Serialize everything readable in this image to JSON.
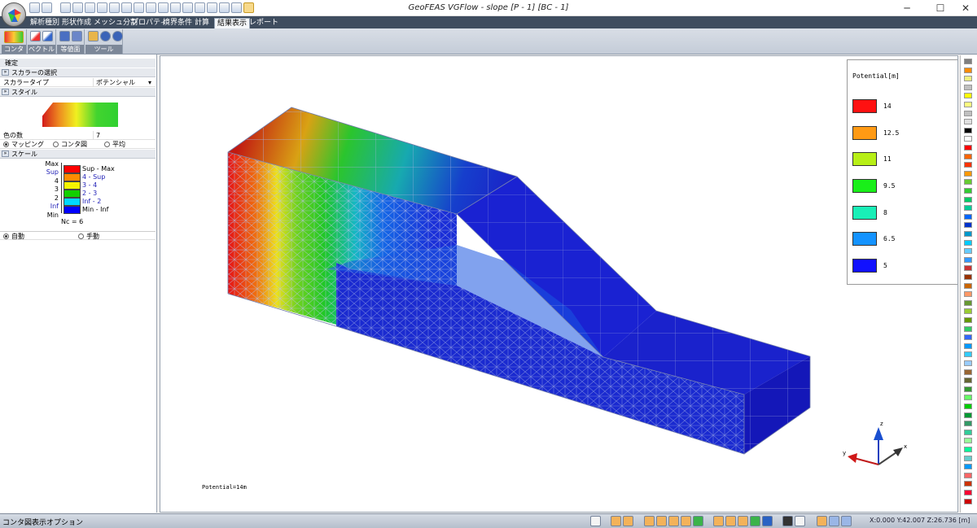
{
  "window": {
    "title": "GeoFEAS VGFlow - slope [P - 1] [BC - 1]",
    "minimize": "─",
    "maximize": "☐",
    "close": "✕"
  },
  "menu": {
    "tabs": [
      {
        "label": "解析種別"
      },
      {
        "label": "形状作成"
      },
      {
        "label": "メッシュ分割"
      },
      {
        "label": "プロパティ"
      },
      {
        "label": "境界条件"
      },
      {
        "label": "計算"
      },
      {
        "label": "結果表示"
      },
      {
        "label": "レポート"
      }
    ],
    "active_tab": "結果表示"
  },
  "ribbon": {
    "groups": [
      {
        "label": "コンタ図"
      },
      {
        "label": "ベクトル"
      },
      {
        "label": "等値面"
      },
      {
        "label": "ツール"
      }
    ]
  },
  "panel": {
    "confirm_label": "確定",
    "scalar_section": "スカラーの選択",
    "scalar_type_label": "スカラータイプ",
    "scalar_type_value": "ポテンシャル",
    "style_section": "スタイル",
    "num_colors_label": "色の数",
    "num_colors_value": "7",
    "mode_options": [
      "マッピング",
      "コンタ図",
      "平均"
    ],
    "mode_selected": "マッピング",
    "scale_section": "スケール",
    "scale_ticks": [
      "Max",
      "Sup",
      "4",
      "3",
      "2",
      "Inf",
      "Min"
    ],
    "scale_bins": [
      {
        "label": "Sup - Max",
        "color": "#ff0000"
      },
      {
        "label": "4 - Sup",
        "color": "#ff8c00"
      },
      {
        "label": "3 - 4",
        "color": "#f5f500"
      },
      {
        "label": "2 - 3",
        "color": "#12d000"
      },
      {
        "label": "Inf - 2",
        "color": "#00d8ff"
      },
      {
        "label": "Min - Inf",
        "color": "#0000ff"
      }
    ],
    "nc_label": "Nc = 6",
    "range_options": [
      "自動",
      "手動"
    ],
    "range_selected": "自動"
  },
  "viewport": {
    "legend_title": "Potential[m]",
    "legend_items": [
      {
        "label": "14",
        "color": "#ff1111"
      },
      {
        "label": "12.5",
        "color": "#ff9a14"
      },
      {
        "label": "11",
        "color": "#b7ef16"
      },
      {
        "label": "9.5",
        "color": "#19ef19"
      },
      {
        "label": "8",
        "color": "#19efb7"
      },
      {
        "label": "6.5",
        "color": "#1493ff"
      },
      {
        "label": "5",
        "color": "#1111ff"
      }
    ],
    "potential_text": "Potential=14m",
    "axis_labels": {
      "x": "x",
      "y": "y",
      "z": "z"
    }
  },
  "palette_colors": [
    "#7f7f7f",
    "#ff8c00",
    "#f0f080",
    "#c0c0c0",
    "#ffff00",
    "#ffff80",
    "#c0c0c0",
    "#e0e0e0",
    "#000000",
    "#ffffff",
    "#ff0000",
    "#ff6600",
    "#ff3300",
    "#ff9900",
    "#66cc33",
    "#33cc33",
    "#00cc66",
    "#00cc99",
    "#0066ff",
    "#0033cc",
    "#0099cc",
    "#00ccff",
    "#66ccff",
    "#3399ff",
    "#cc3333",
    "#993300",
    "#cc6600",
    "#ff9966",
    "#669933",
    "#99cc33",
    "#669900",
    "#33cc66",
    "#3366ff",
    "#0099ff",
    "#33ccff",
    "#99ccff",
    "#996633",
    "#666633",
    "#339933",
    "#66ff66",
    "#00cc00",
    "#009933",
    "#339966",
    "#33cc99",
    "#99ff99",
    "#00ff99",
    "#66cccc",
    "#0099ff",
    "#ff6666",
    "#cc3300",
    "#ff0033",
    "#cc0000"
  ],
  "status": {
    "text": "コンタ図表示オプション",
    "coords": "X:0.000 Y:42.007 Z:26.736 [m]"
  }
}
